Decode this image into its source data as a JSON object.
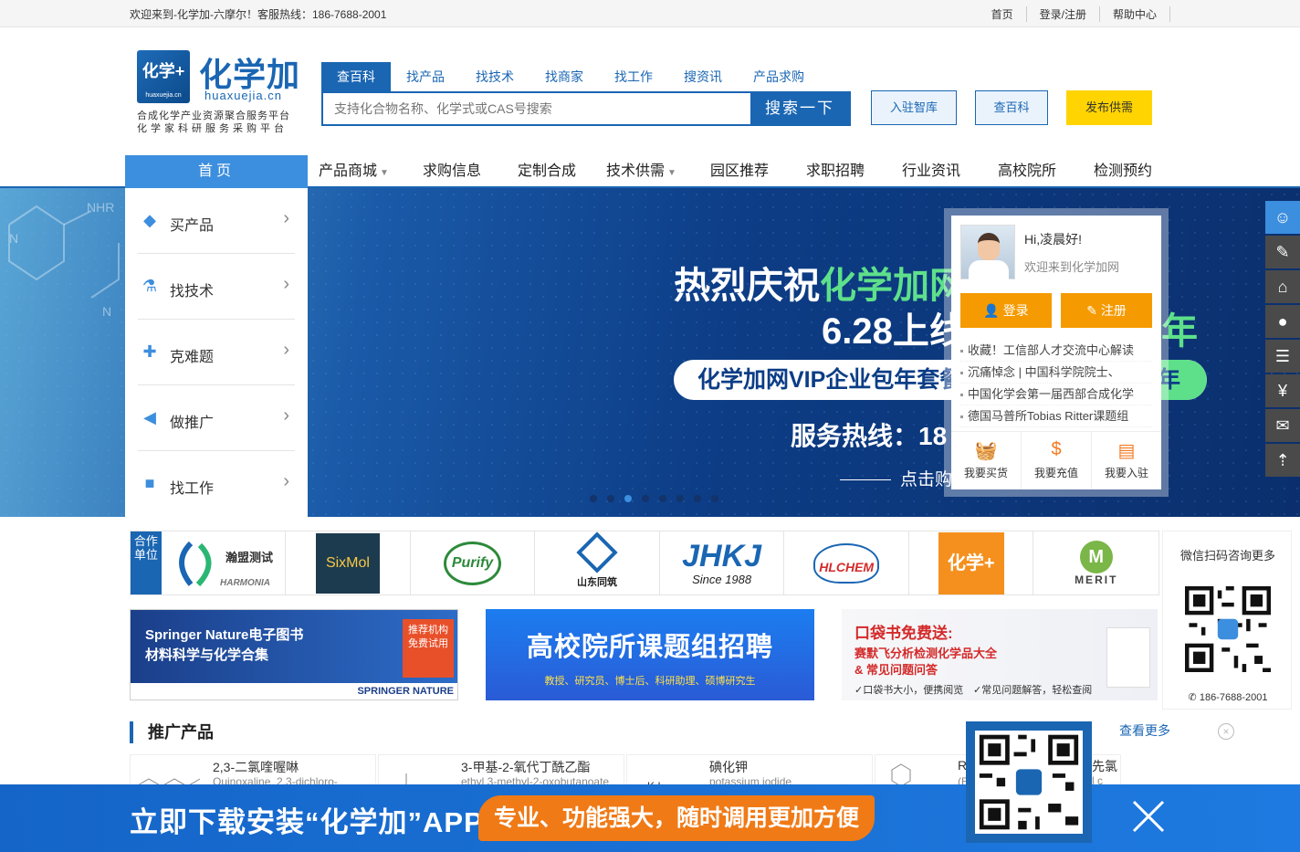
{
  "topbar": {
    "welcome": "欢迎来到-化学加-六摩尔！客服热线：186-7688-2001",
    "links": [
      "首页",
      "登录/注册",
      "帮助中心"
    ]
  },
  "logo": {
    "mark": "化学+",
    "mark_sub": "huaxuejia.cn",
    "cn": "化学加",
    "en": "huaxuejia.cn",
    "slogan1": "合成化学产业资源聚合服务平台",
    "slogan2": "化学家科研服务采购平台"
  },
  "search": {
    "tabs": [
      "查百科",
      "找产品",
      "找技术",
      "找商家",
      "找工作",
      "搜资讯",
      "产品求购"
    ],
    "active_tab": 0,
    "placeholder": "支持化合物名称、化学式或CAS号搜索",
    "button": "搜索一下"
  },
  "header_buttons": {
    "join": "入驻智库",
    "wiki": "查百科",
    "publish": "发布供需"
  },
  "nav": {
    "home": "首页",
    "items": [
      {
        "label": "产品商城",
        "dropdown": true
      },
      {
        "label": "求购信息",
        "dropdown": false
      },
      {
        "label": "定制合成",
        "dropdown": false
      },
      {
        "label": "技术供需",
        "dropdown": true
      },
      {
        "label": "园区推荐",
        "dropdown": false
      },
      {
        "label": "求职招聘",
        "dropdown": false
      },
      {
        "label": "行业资讯",
        "dropdown": false
      },
      {
        "label": "高校院所",
        "dropdown": false
      },
      {
        "label": "检测预约",
        "dropdown": false
      }
    ]
  },
  "side_menu": [
    {
      "label": "买产品",
      "icon": "cube-icon"
    },
    {
      "label": "找技术",
      "icon": "flask-icon"
    },
    {
      "label": "克难题",
      "icon": "puzzle-icon"
    },
    {
      "label": "做推广",
      "icon": "megaphone-icon"
    },
    {
      "label": "找工作",
      "icon": "briefcase-icon"
    }
  ],
  "banner": {
    "line1_a": "热烈庆祝",
    "line1_b": "化学加网",
    "line2": "6.28上线",
    "line2_right": "年",
    "pill": "化学加网VIP企业包年套餐",
    "pill_end": "年",
    "hotline": "服务热线：18",
    "cta": "点击购",
    "slide_count": 8,
    "active_slide": 2
  },
  "login_card": {
    "greeting": "Hi,凌晨好!",
    "welcome": "欢迎来到化学加网",
    "login": "登录",
    "register": "注册",
    "news": [
      "收藏！工信部人才交流中心解读",
      "沉痛悼念 | 中国科学院院士、",
      "中国化学会第一届西部合成化学",
      "德国马普所Tobias Ritter课题组"
    ],
    "actions": [
      "我要买货",
      "我要充值",
      "我要入驻"
    ]
  },
  "partners": {
    "tag": "合作单位",
    "items": [
      "瀚盟测试",
      "SixMol",
      "Purify",
      "山东同筑",
      "JHKJ",
      "HLCHEM",
      "化学+",
      "MERIT"
    ],
    "item_sub": {
      "jhkj": "Since 1988",
      "harmonia": "HARMONIA",
      "shandong": "山东同筑"
    }
  },
  "ads": {
    "springer_title": "Springer Nature电子图书",
    "springer_sub": "材料科学与化学合集",
    "springer_tag": "推荐机构免费试用",
    "springer_brand": "SPRINGER NATURE",
    "recruit_title": "高校院所课题组招聘",
    "recruit_sub": "教授、研究员、博士后、科研助理、硕博研究生",
    "book_title": "口袋书免费送:",
    "book_sub1": "赛默飞分析检测化学品大全",
    "book_sub2": "& 常见问题问答",
    "book_note1": "口袋书大小，便携阅览",
    "book_note2": "常见问题解答，轻松查阅"
  },
  "qr_side": {
    "title": "微信扫码咨询更多",
    "phone": "186-7688-2001"
  },
  "products": {
    "section_title": "推广产品",
    "more": "查看更多",
    "items": [
      {
        "name": "2,3-二氯喹喔啉",
        "en": "Quinoxaline, 2,3-dichloro-"
      },
      {
        "name": "3-甲基-2-氧代丁酰乙酯",
        "en": "ethyl 3-methyl-2-oxobutanoate"
      },
      {
        "name": "碘化钾",
        "en": "potassium iodide"
      },
      {
        "name": "R",
        "en": "(E"
      }
    ],
    "partial_right": {
      "name": "先氯",
      "en": "l c"
    }
  },
  "appbar": {
    "headline": "立即下载安装“化学加”APP",
    "slogan": "专业、功能强大，随时调用更加方便"
  },
  "float_icons": [
    "qq-icon",
    "edit-icon",
    "store-icon",
    "user-icon",
    "chat-icon",
    "yuan-icon",
    "wechat-icon",
    "back-to-top-icon"
  ],
  "colors": {
    "brand": "#1a66b3",
    "accent_orange": "#f59a00",
    "yellow": "#ffd400",
    "banner_green": "#5ee08a"
  }
}
